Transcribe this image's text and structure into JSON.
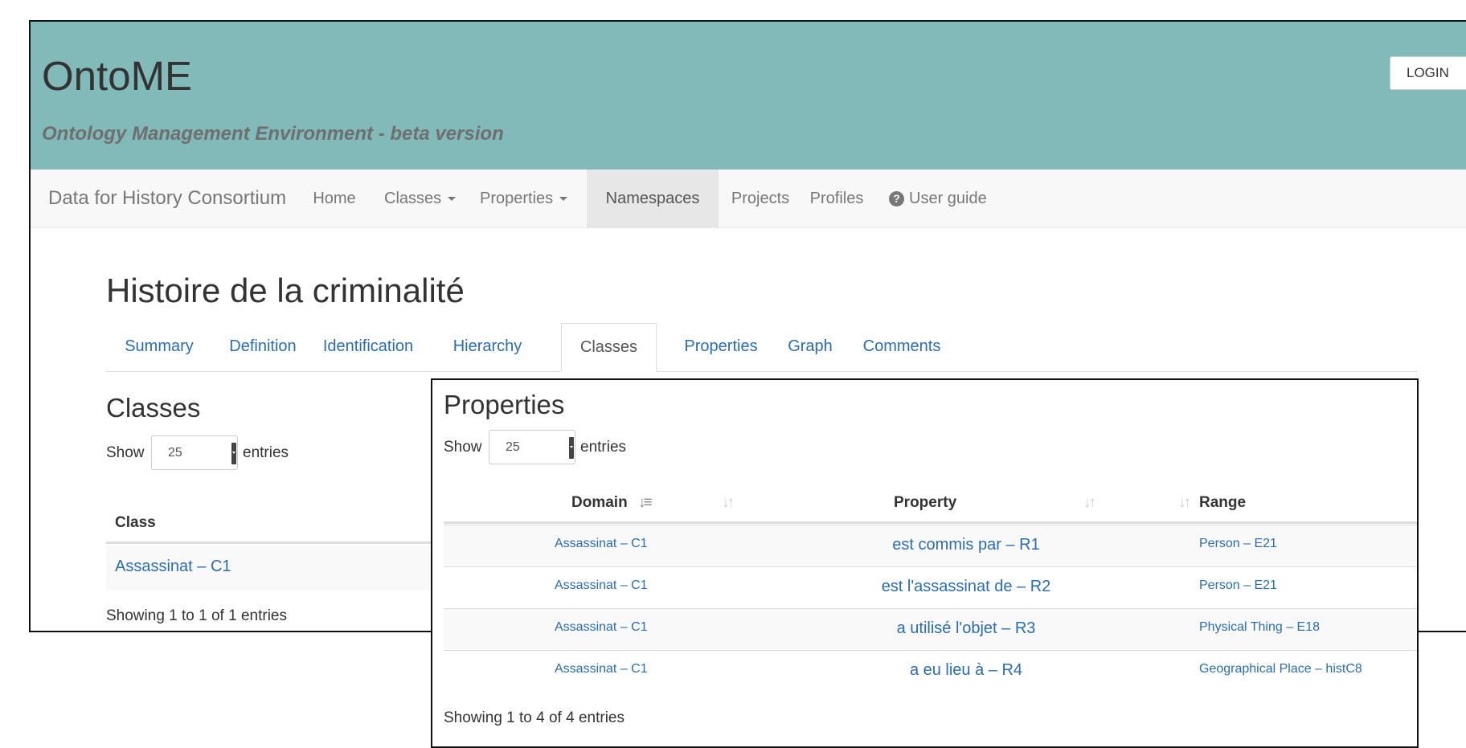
{
  "header": {
    "title": "OntoME",
    "subtitle": "Ontology Management Environment - beta version",
    "login_label": "LOGIN"
  },
  "navbar": {
    "brand": "Data for History Consortium",
    "items": [
      {
        "label": "Home"
      },
      {
        "label": "Classes"
      },
      {
        "label": "Properties"
      },
      {
        "label": "Namespaces"
      },
      {
        "label": "Projects"
      },
      {
        "label": "Profiles"
      },
      {
        "label": "User guide"
      }
    ],
    "active": "Namespaces"
  },
  "page": {
    "title": "Histoire de la criminalité"
  },
  "tabs": {
    "items": [
      {
        "label": "Summary"
      },
      {
        "label": "Definition"
      },
      {
        "label": "Identification"
      },
      {
        "label": "Hierarchy"
      },
      {
        "label": "Classes"
      },
      {
        "label": "Properties"
      },
      {
        "label": "Graph"
      },
      {
        "label": "Comments"
      }
    ],
    "active": "Classes"
  },
  "classes_section": {
    "heading": "Classes",
    "show_label": "Show",
    "entries_value": "25",
    "entries_label": "entries",
    "column_header": "Class",
    "rows": [
      {
        "class": "Assassinat – C1"
      }
    ],
    "info": "Showing 1 to 1 of 1 entries"
  },
  "properties_section": {
    "heading": "Properties",
    "show_label": "Show",
    "entries_value": "25",
    "entries_label": "entries",
    "columns": {
      "domain": "Domain",
      "property": "Property",
      "range": "Range"
    },
    "rows": [
      {
        "domain": "Assassinat – C1",
        "property": "est commis par – R1",
        "range": "Person – E21"
      },
      {
        "domain": "Assassinat – C1",
        "property": "est l'assassinat de – R2",
        "range": "Person – E21"
      },
      {
        "domain": "Assassinat – C1",
        "property": "a utilisé l'objet – R3",
        "range": "Physical Thing – E18"
      },
      {
        "domain": "Assassinat – C1",
        "property": "a eu lieu à – R4",
        "range": "Geographical Place – histC8"
      }
    ],
    "info": "Showing 1 to 4 of 4 entries"
  },
  "icons": {
    "caret": "caret-down-icon",
    "help": "question-circle-icon",
    "sort": "sort-icon",
    "sort_active": "sort-amount-asc-icon"
  },
  "colors": {
    "banner": "#82b9b9",
    "link": "#2a6db0",
    "navbar_bg": "#f8f8f8",
    "nav_active_bg": "#e7e7e7"
  }
}
